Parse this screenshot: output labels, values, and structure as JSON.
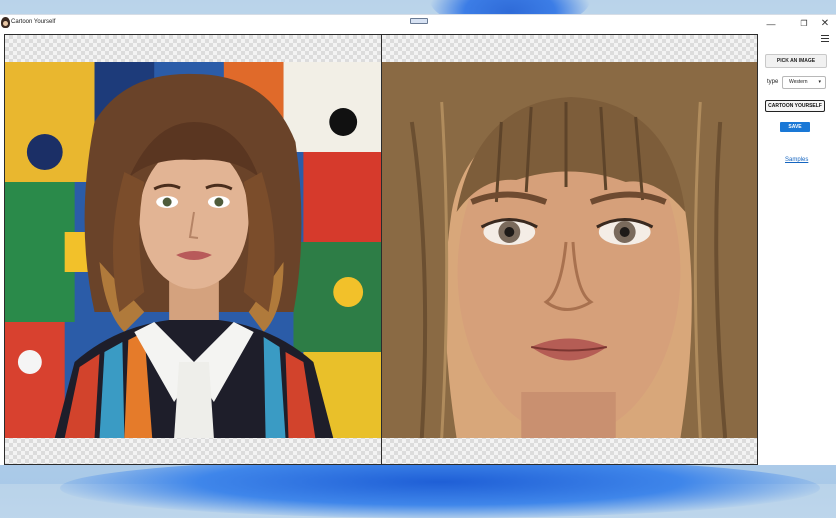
{
  "window": {
    "title": "Cartoon Yourself",
    "controls": {
      "minimize": "—",
      "maximize": "❐",
      "close": "✕"
    }
  },
  "panes": {
    "left": {
      "label": "original-image",
      "icon": "photo"
    },
    "right": {
      "label": "cartoon-result",
      "icon": "photo"
    }
  },
  "sidebar": {
    "pick_button": "PICK AN IMAGE",
    "type_label": "type",
    "type_value": "Western",
    "cartoon_button": "CARTOON YOURSELF",
    "save_button": "SAVE",
    "samples_link": "Samples"
  },
  "colors": {
    "accent": "#1a78d6",
    "link": "#1565c0"
  }
}
